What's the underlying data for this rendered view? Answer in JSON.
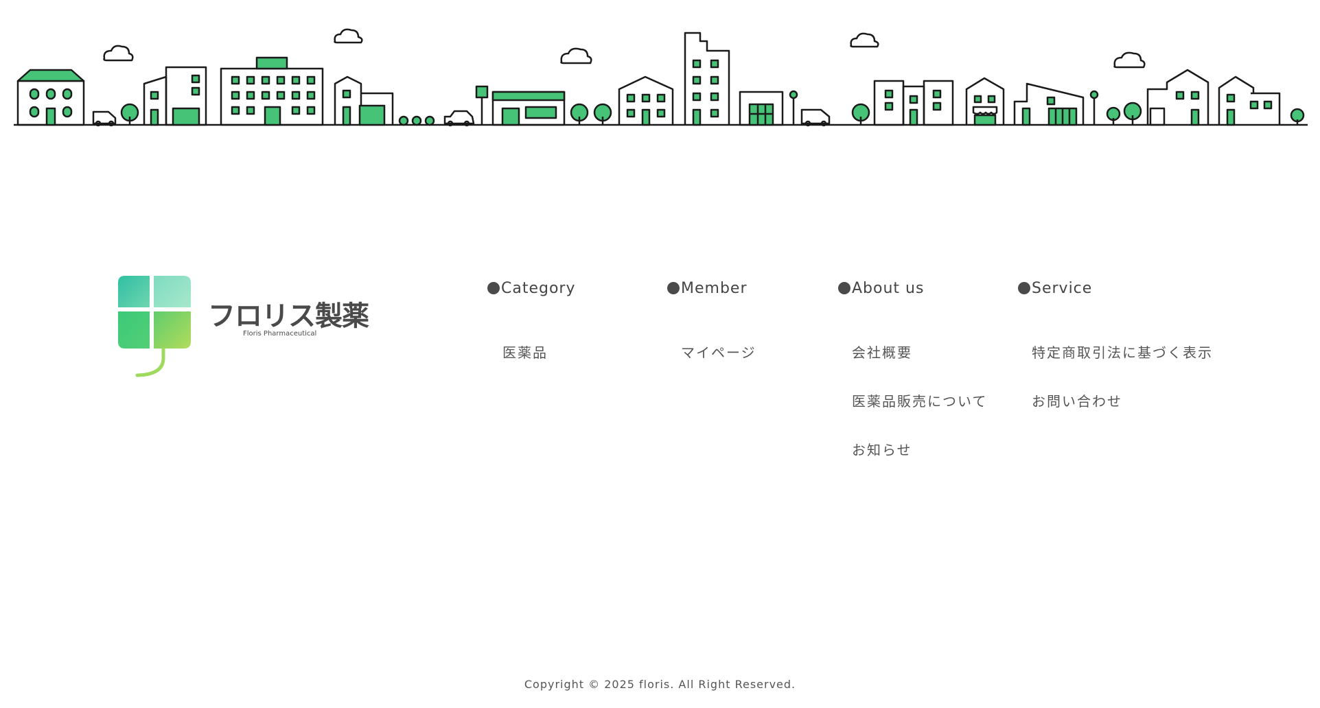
{
  "logo": {
    "name": "フロリス製薬",
    "subtitle": "Floris Pharmaceutical"
  },
  "nav": {
    "columns": [
      {
        "heading": "Category",
        "links": [
          "医薬品"
        ]
      },
      {
        "heading": "Member",
        "links": [
          "マイページ"
        ]
      },
      {
        "heading": "About us",
        "links": [
          "会社概要",
          "医薬品販売について",
          "お知らせ"
        ]
      },
      {
        "heading": "Service",
        "links": [
          "特定商取引法に基づく表示",
          "お問い合わせ"
        ]
      }
    ]
  },
  "footer": {
    "copyright": "Copyright © 2025 floris. All Right Reserved."
  },
  "colors": {
    "accent": "#46c376",
    "text": "#444444",
    "line": "#1a1a1a"
  },
  "icons": [
    "city-skyline-illustration",
    "logo-cross-icon"
  ]
}
